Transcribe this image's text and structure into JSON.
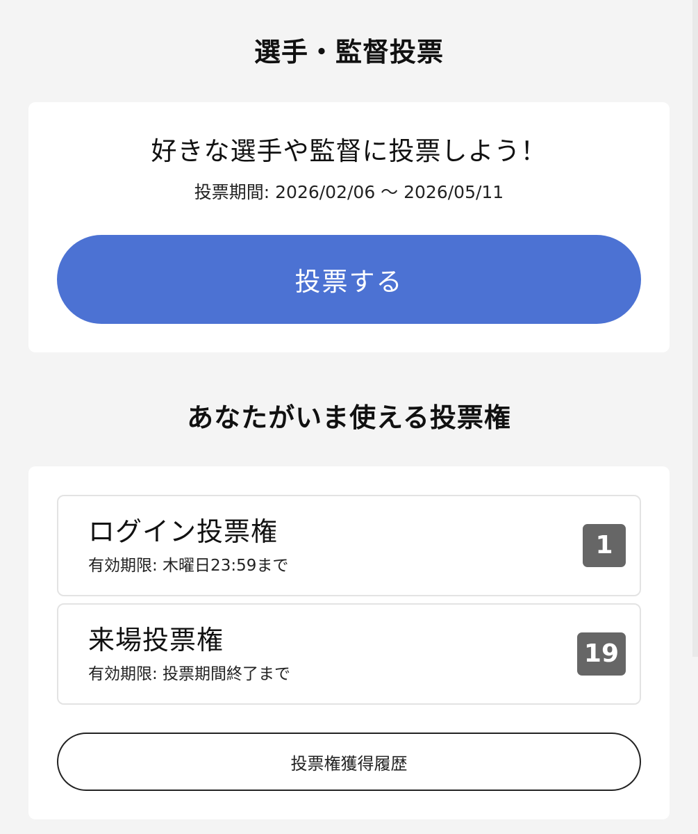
{
  "page": {
    "title": "選手・監督投票"
  },
  "vote_card": {
    "headline": "好きな選手や監督に投票しよう！",
    "period": "投票期間: 2026/02/06 〜 2026/05/11",
    "button_label": "投票する"
  },
  "rights_section": {
    "title": "あなたがいま使える投票権",
    "items": [
      {
        "name": "ログイン投票権",
        "expiry": "有効期限: 木曜日23:59まで",
        "count": "1"
      },
      {
        "name": "来場投票権",
        "expiry": "有効期限: 投票期間終了まで",
        "count": "19"
      }
    ],
    "history_button_label": "投票権獲得履歴"
  },
  "colors": {
    "background": "#f4f4f4",
    "accent": "#4c72d3",
    "badge": "#666666"
  }
}
